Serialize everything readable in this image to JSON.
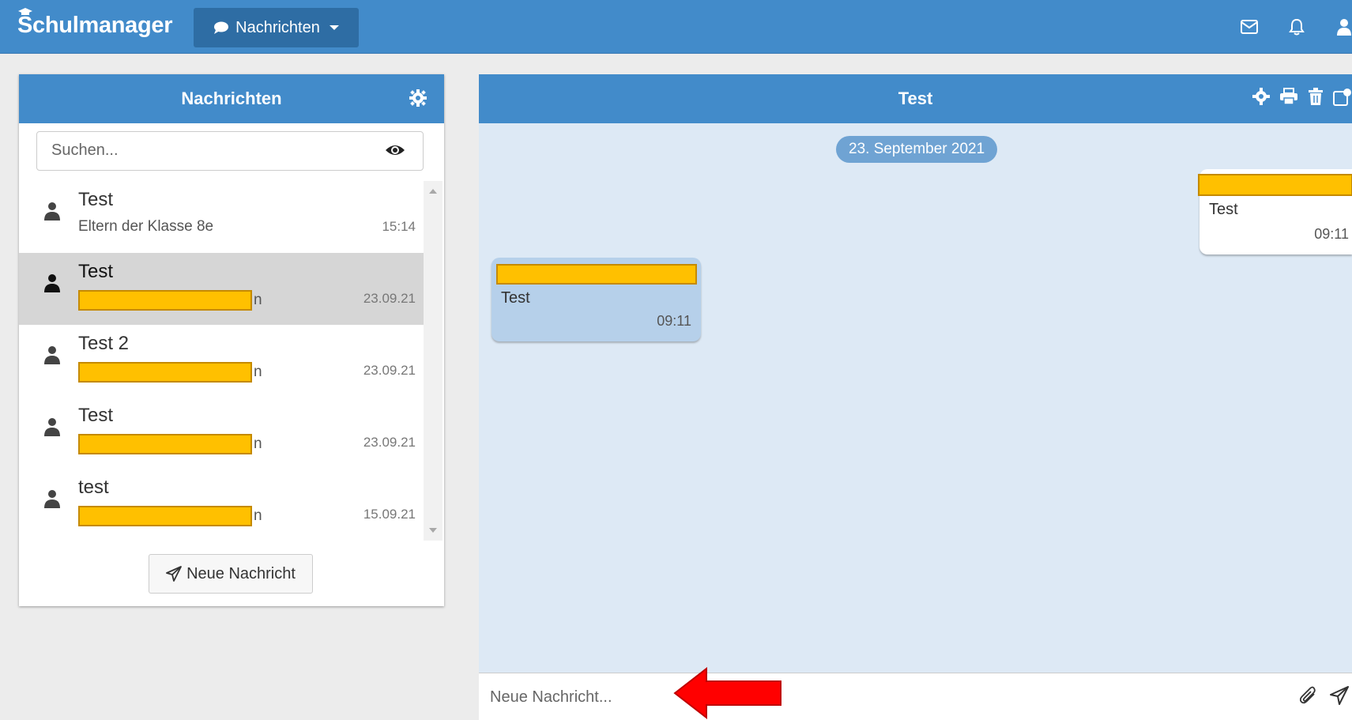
{
  "navbar": {
    "brand": "Schulmanager",
    "dropdown_label": "Nachrichten"
  },
  "left_panel": {
    "title": "Nachrichten",
    "search_placeholder": "Suchen...",
    "conversations": [
      {
        "title": "Test",
        "subtitle": "Eltern der Klasse 8e",
        "time": "15:14",
        "redacted": false,
        "active": false
      },
      {
        "title": "Test",
        "subtitle": "n",
        "time": "23.09.21",
        "redacted": true,
        "active": true
      },
      {
        "title": "Test 2",
        "subtitle": "n",
        "time": "23.09.21",
        "redacted": true,
        "active": false
      },
      {
        "title": "Test",
        "subtitle": "n",
        "time": "23.09.21",
        "redacted": true,
        "active": false
      },
      {
        "title": "test",
        "subtitle": "n",
        "time": "15.09.21",
        "redacted": true,
        "active": false
      }
    ],
    "new_message_label": "Neue Nachricht"
  },
  "chat": {
    "title": "Test",
    "date_separator": "23. September 2021",
    "messages": [
      {
        "text": "Test",
        "time": "09:11",
        "own": true
      },
      {
        "text": "Test",
        "time": "09:11",
        "own": false
      }
    ],
    "composer_placeholder": "Neue Nachricht..."
  },
  "colors": {
    "primary": "#428bca",
    "chat_background": "#dde9f5",
    "redaction": "#ffc000",
    "annotation_arrow": "#ff0000"
  }
}
